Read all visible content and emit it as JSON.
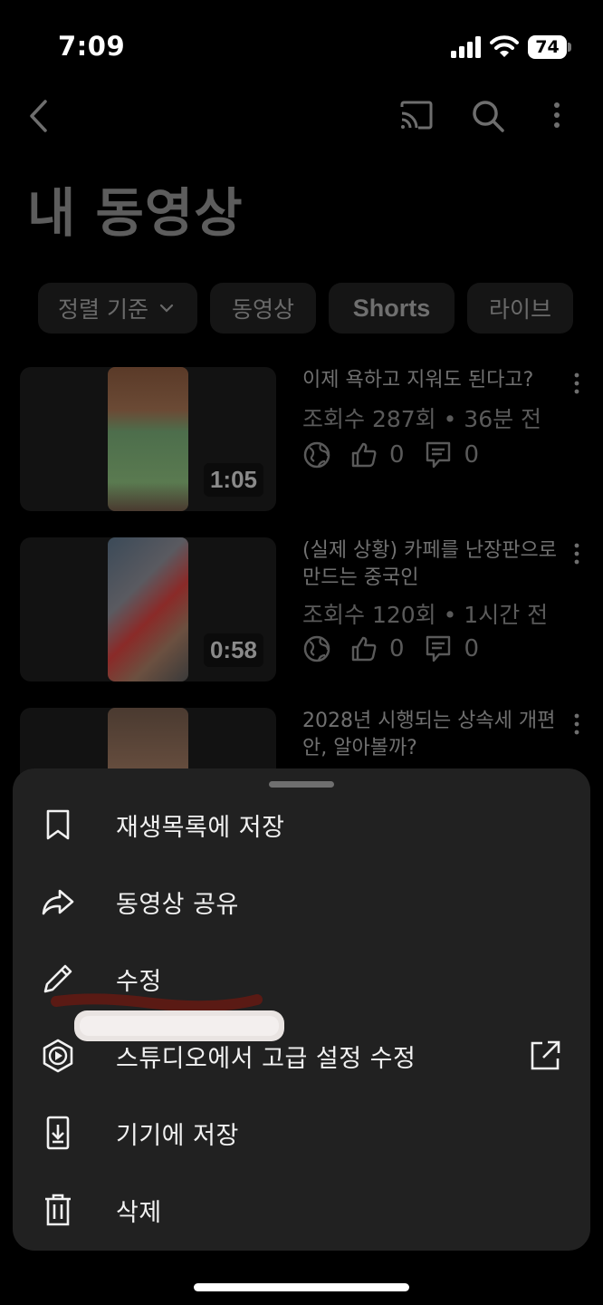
{
  "status_bar": {
    "time": "7:09",
    "battery": "74"
  },
  "header": {
    "back_icon": "chevron-left-icon",
    "cast_icon": "cast-icon",
    "search_icon": "search-icon",
    "more_icon": "more-vert-icon"
  },
  "page": {
    "title": "내 동영상"
  },
  "filters": {
    "sort_label": "정렬 기준",
    "chips": [
      "동영상",
      "Shorts",
      "라이브"
    ]
  },
  "videos": [
    {
      "title": "이제 욕하고 지워도 된다고?",
      "meta": "조회수 287회 • 36분 전",
      "duration": "1:05",
      "likes": "0",
      "comments": "0"
    },
    {
      "title": "(실제 상황) 카페를 난장판으로 만드는 중국인",
      "meta": "조회수 120회 • 1시간 전",
      "duration": "0:58",
      "likes": "0",
      "comments": "0"
    },
    {
      "title": "2028년 시행되는 상속세 개편안, 알아볼까?"
    }
  ],
  "menu": {
    "items": [
      {
        "label": "재생목록에 저장",
        "icon": "bookmark-icon"
      },
      {
        "label": "동영상 공유",
        "icon": "share-icon"
      },
      {
        "label": "수정",
        "icon": "pencil-icon"
      },
      {
        "label": "스튜디오에서 고급 설정 수정",
        "icon": "studio-icon",
        "trailing_icon": "open-external-icon"
      },
      {
        "label": "기기에 저장",
        "icon": "download-device-icon"
      },
      {
        "label": "삭제",
        "icon": "trash-icon"
      }
    ]
  },
  "colors": {
    "sheet_bg": "#212121",
    "background": "#000000"
  }
}
